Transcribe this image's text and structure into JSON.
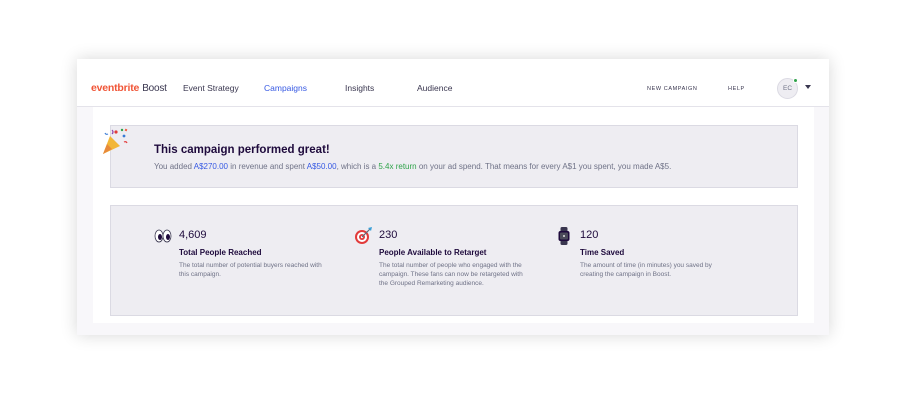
{
  "header": {
    "brand_logo": "eventbrite",
    "brand_sub": "Boost",
    "nav": [
      {
        "label": "Event Strategy",
        "active": false
      },
      {
        "label": "Campaigns",
        "active": true
      },
      {
        "label": "Insights",
        "active": false
      },
      {
        "label": "Audience",
        "active": false
      }
    ],
    "new_campaign": "NEW CAMPAIGN",
    "help": "HELP",
    "avatar_initials": "EC",
    "avatar_status_color": "#2fa34a"
  },
  "performance": {
    "icon": "party-popper-icon",
    "title": "This campaign performed great!",
    "body": {
      "t1": "You added ",
      "revenue": "A$270.00",
      "t2": " in revenue and spent ",
      "spend": "A$50.00",
      "t3": ", which is a ",
      "return_value": "5.4x return",
      "t4": " on your ad spend. That means for every A$1 you spent, you made A$5."
    }
  },
  "stats": [
    {
      "icon": "eyes-icon",
      "value": "4,609",
      "label": "Total People Reached",
      "description": "The total number of potential buyers reached with this campaign."
    },
    {
      "icon": "target-icon",
      "value": "230",
      "label": "People Available to Retarget",
      "description": "The total number of people who engaged with the campaign. These fans can now be retargeted with the Grouped Remarketing audience."
    },
    {
      "icon": "watch-icon",
      "value": "120",
      "label": "Time Saved",
      "description": "The amount of time (in minutes) you saved by creating the campaign in Boost."
    }
  ],
  "colors": {
    "brand": "#f05537",
    "accent_blue": "#3659e3",
    "accent_green": "#2fa34a"
  }
}
